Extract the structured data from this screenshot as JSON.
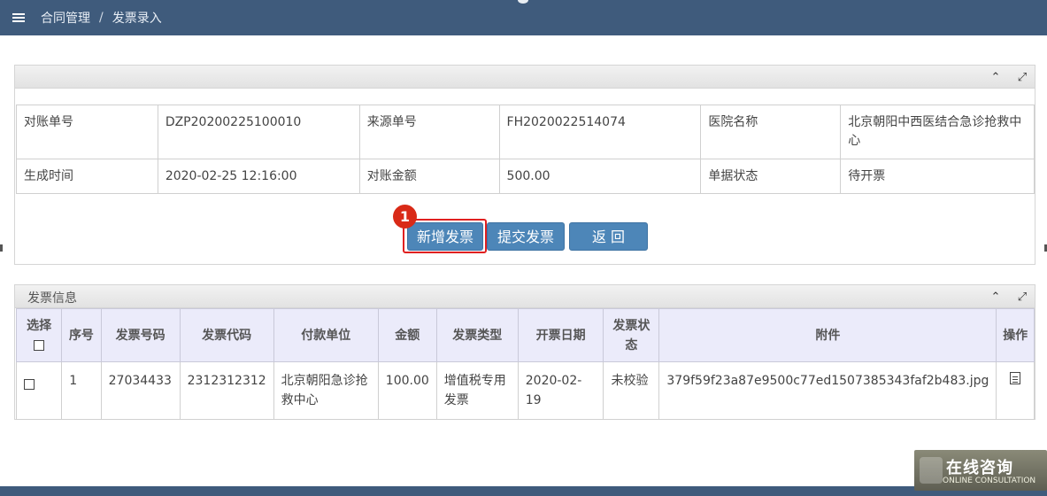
{
  "breadcrumb": {
    "parent": "合同管理",
    "separator": "/",
    "current": "发票录入"
  },
  "summary": {
    "rows": [
      [
        {
          "label": "对账单号",
          "value": "DZP20200225100010"
        },
        {
          "label": "来源单号",
          "value": "FH2020022514074"
        },
        {
          "label": "医院名称",
          "value": "北京朝阳中西医结合急诊抢救中心"
        }
      ],
      [
        {
          "label": "生成时间",
          "value": "2020-02-25 12:16:00"
        },
        {
          "label": "对账金额",
          "value": "500.00"
        },
        {
          "label": "单据状态",
          "value": "待开票"
        }
      ]
    ]
  },
  "actions": {
    "add": "新增发票",
    "submit": "提交发票",
    "back": "返 回",
    "step_badge": "1"
  },
  "invoice_panel": {
    "title": "发票信息",
    "headers": {
      "select": "选择",
      "seq": "序号",
      "number": "发票号码",
      "code": "发票代码",
      "payer": "付款单位",
      "amount": "金额",
      "type": "发票类型",
      "date": "开票日期",
      "status": "发票状态",
      "attachment": "附件",
      "op": "操作"
    },
    "rows": [
      {
        "seq": "1",
        "number": "27034433",
        "code": "2312312312",
        "payer": "北京朝阳急诊抢救中心",
        "amount": "100.00",
        "type": "增值税专用发票",
        "date": "2020-02-19",
        "status": "未校验",
        "attachment": "379f59f23a87e9500c77ed1507385343faf2b483.jpg"
      }
    ]
  },
  "consult": {
    "main": "在线咨询",
    "sub": "ONLINE CONSULTATION"
  },
  "colors": {
    "topbar": "#3f5b7c",
    "button": "#4d86b8",
    "highlight": "#e02020",
    "header_bg": "#ebebfa"
  },
  "icons": {
    "menu": "menu-icon",
    "collapse": "chevron-up-icon",
    "expand": "expand-icon",
    "file": "file-text-icon"
  }
}
